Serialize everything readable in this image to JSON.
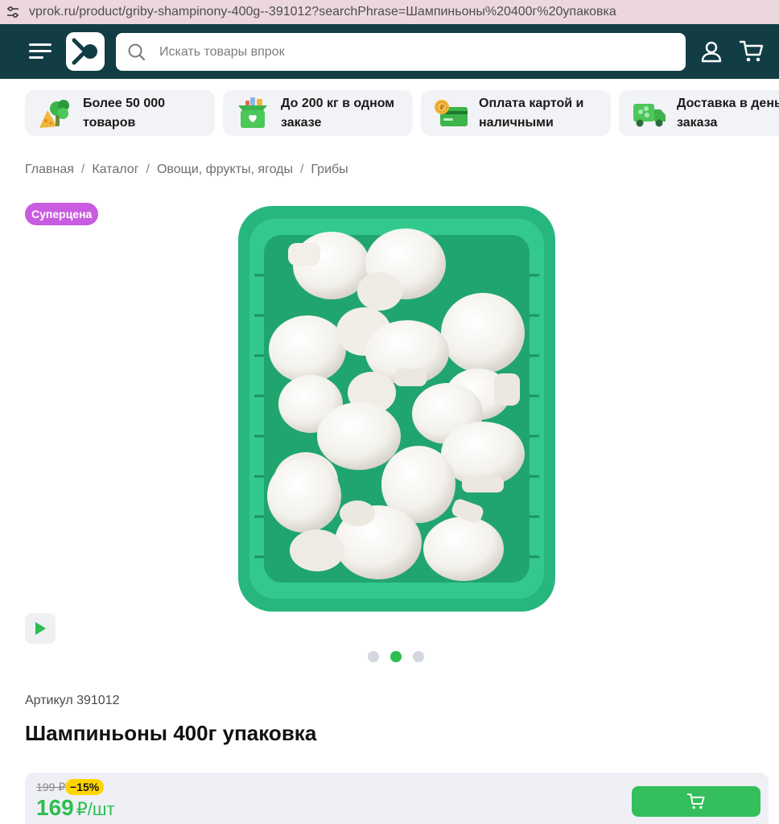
{
  "browser": {
    "url": "vprok.ru/product/griby-shampinony-400g--391012?searchPhrase=Шампиньоны%20400г%20упаковка",
    "icons": [
      "site-settings-icon"
    ]
  },
  "header": {
    "search_placeholder": "Искать товары впрок",
    "icons": [
      "menu-icon",
      "logo",
      "search-icon",
      "user-icon",
      "cart-icon"
    ],
    "colors": {
      "background": "#123d44"
    }
  },
  "benefits": [
    {
      "label": "Более 50 000 товаров",
      "icon": "vegetables-icon"
    },
    {
      "label": "До 200 кг в одном заказе",
      "icon": "box-icon"
    },
    {
      "label": "Оплата картой и наличными",
      "icon": "card-icon"
    },
    {
      "label": "Доставка в день заказа",
      "icon": "truck-icon"
    }
  ],
  "breadcrumbs": [
    "Главная",
    "Каталог",
    "Овощи, фрукты, ягоды",
    "Грибы"
  ],
  "product": {
    "badge": "Суперцена",
    "image": "mushrooms-in-green-tray",
    "gallery": {
      "count": 3,
      "active": 2
    },
    "sku": "Артикул 391012",
    "title": "Шампиньоны 400г упаковка"
  },
  "price": {
    "old": "199 ₽",
    "discount": "−15%",
    "current": "169",
    "unit": "₽/шт"
  },
  "colors": {
    "accent": "#2dbe50",
    "badge": "#c95ce0",
    "discount": "#ffd400"
  }
}
